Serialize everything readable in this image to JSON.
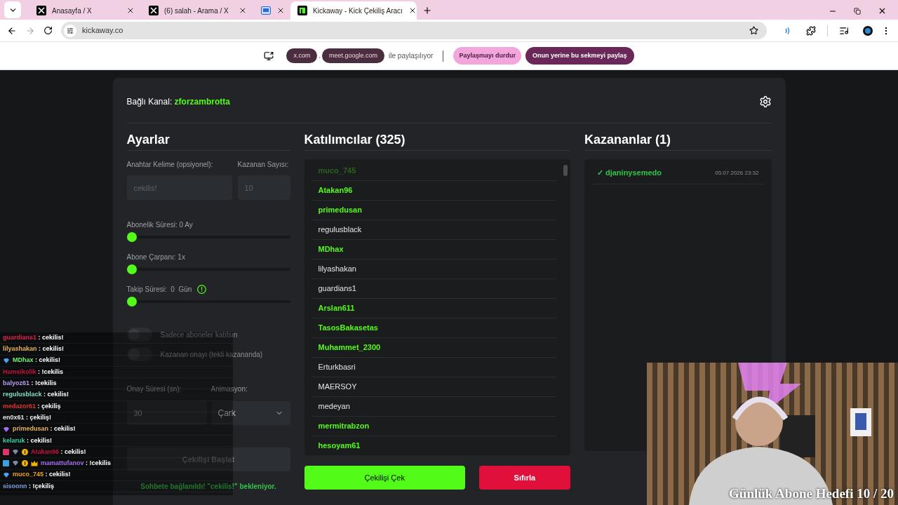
{
  "browser": {
    "tabs": [
      {
        "title": "Anasayfa / X",
        "kind": "x",
        "selected": false
      },
      {
        "title": "(6) salah - Arama / X",
        "kind": "x",
        "selected": false
      },
      {
        "kind": "screen",
        "selected": false
      },
      {
        "title": "Kickaway - Kick Çekiliş Aracı",
        "kind": "kick",
        "selected": true
      }
    ],
    "url": "kickaway.co"
  },
  "share_bar": {
    "sites": [
      "x.com",
      "meet.google.com"
    ],
    "separator": ",",
    "sharing_text": "ile paylaşılıyor",
    "stop_button": "Paylaşmayı durdur",
    "share_this_button": "Onun yerine bu sekmeyi paylaş"
  },
  "channel": {
    "label": "Bağlı Kanal:",
    "name": "zforzambrotta"
  },
  "settings": {
    "title": "Ayarlar",
    "keyword": {
      "label": "Anahtar Kelime (opsiyonel):",
      "placeholder": "cekilis!"
    },
    "winner_count": {
      "label": "Kazanan Sayısı:",
      "placeholder": "10"
    },
    "sliders": [
      {
        "label": "Abonelik Süresi: 0 Ay",
        "level": 0,
        "info": false
      },
      {
        "label": "Abone Çarpanı: 1x",
        "level": 0,
        "info": false
      },
      {
        "label": "Takip Süresi:  0  Gün",
        "level": 0,
        "info": true
      }
    ],
    "toggles": [
      {
        "label": "Sadece aboneler katılsın",
        "on": false
      },
      {
        "label": "Kazanan onayı (tekli kazananda)",
        "on": false
      }
    ],
    "confirm_time": {
      "label": "Onay Süresi (sn):",
      "placeholder": "30"
    },
    "animation": {
      "label": "Animasyon:",
      "value": "Çark"
    },
    "start_button": {
      "label": "Çekilişi Başlat",
      "disabled": true
    },
    "status": "Sohbete bağlanıldı! \"cekilis!\" bekleniyor."
  },
  "participants": {
    "title": "Katılımcılar (325)",
    "items": [
      {
        "name": "muco_745",
        "highlight": true,
        "faded": true
      },
      {
        "name": "Atakan96",
        "highlight": true,
        "faded": false
      },
      {
        "name": "primedusan",
        "highlight": true,
        "faded": false
      },
      {
        "name": "regulusblack",
        "highlight": false,
        "faded": false
      },
      {
        "name": "MDhax",
        "highlight": true,
        "faded": false
      },
      {
        "name": "lilyashakan",
        "highlight": false,
        "faded": false
      },
      {
        "name": "guardians1",
        "highlight": false,
        "faded": false
      },
      {
        "name": "Arslan611",
        "highlight": true,
        "faded": false
      },
      {
        "name": "TasosBakasetas",
        "highlight": true,
        "faded": false
      },
      {
        "name": "Muhammet_2300",
        "highlight": true,
        "faded": false
      },
      {
        "name": "Erturkbasri",
        "highlight": false,
        "faded": false
      },
      {
        "name": "MAERSOY",
        "highlight": false,
        "faded": false
      },
      {
        "name": "medeyan",
        "highlight": false,
        "faded": false
      },
      {
        "name": "mermitrabzon",
        "highlight": true,
        "faded": false
      },
      {
        "name": "hesoyam61",
        "highlight": true,
        "faded": false
      }
    ],
    "draw_button": "Çekilişi Çek",
    "reset_button": "Sıfırla"
  },
  "winners": {
    "title": "Kazananlar (1)",
    "items": [
      {
        "check": "✓",
        "name": "djaninysemedo",
        "time": "05.07.2026 23:32"
      }
    ]
  },
  "chat": [
    {
      "user": "guardians1",
      "color": "#e0234e",
      "message": ": cekilis!"
    },
    {
      "user": "lilyashakan",
      "color": "#e3b35a",
      "message": ": cekilis!"
    },
    {
      "user": "MDhax",
      "color": "#6ef56e",
      "message": ": cekilis!",
      "badges": [
        {
          "kind": "gem",
          "color": "#4aa3f0"
        }
      ]
    },
    {
      "user": "Hamsikolik",
      "color": "#c8103c",
      "message": ": !cekilis"
    },
    {
      "user": "balyoz61",
      "color": "#b49cf0",
      "message": ": !cekilis"
    },
    {
      "user": "regulusblack",
      "color": "#7fe0c0",
      "message": ": cekilis!"
    },
    {
      "user": "medazor61",
      "color": "#e0342c",
      "message": ": çekiliş"
    },
    {
      "user": "en0x61",
      "color": "#e6e6e6",
      "message": ": çekiliş!"
    },
    {
      "user": "primedusan",
      "color": "#e3b35a",
      "message": ": cekilis!",
      "badges": [
        {
          "kind": "gem",
          "color": "#a66cf0"
        }
      ]
    },
    {
      "user": "kelaruk",
      "color": "#3ad0a0",
      "message": ": cekilis!"
    },
    {
      "user": "Atakan96",
      "color": "#c8103c",
      "message": ": cekilis!",
      "badges": [
        {
          "kind": "box",
          "color": "#e0346c"
        },
        {
          "kind": "gem",
          "color": "#7a8aa0"
        },
        {
          "kind": "coin",
          "color": "#f0b400"
        }
      ]
    },
    {
      "user": "mamattufanov",
      "color": "#a66cf0",
      "message": ": !cekilis",
      "badges": [
        {
          "kind": "box",
          "color": "#3aa0e0"
        },
        {
          "kind": "gem",
          "color": "#7a8aa0"
        },
        {
          "kind": "coin",
          "color": "#f0b400"
        },
        {
          "kind": "crown",
          "color": "#f0b400"
        }
      ]
    },
    {
      "user": "muco_745",
      "color": "#f0a020",
      "message": ": cekilis!",
      "badges": [
        {
          "kind": "gem",
          "color": "#4aa3f0"
        }
      ]
    },
    {
      "user": "sisoonn",
      "color": "#7aa0e0",
      "message": ": !çekiliş"
    }
  ],
  "stream_overlay": {
    "goal_text": "Günlük Abone Hedefi 10 / 20"
  }
}
